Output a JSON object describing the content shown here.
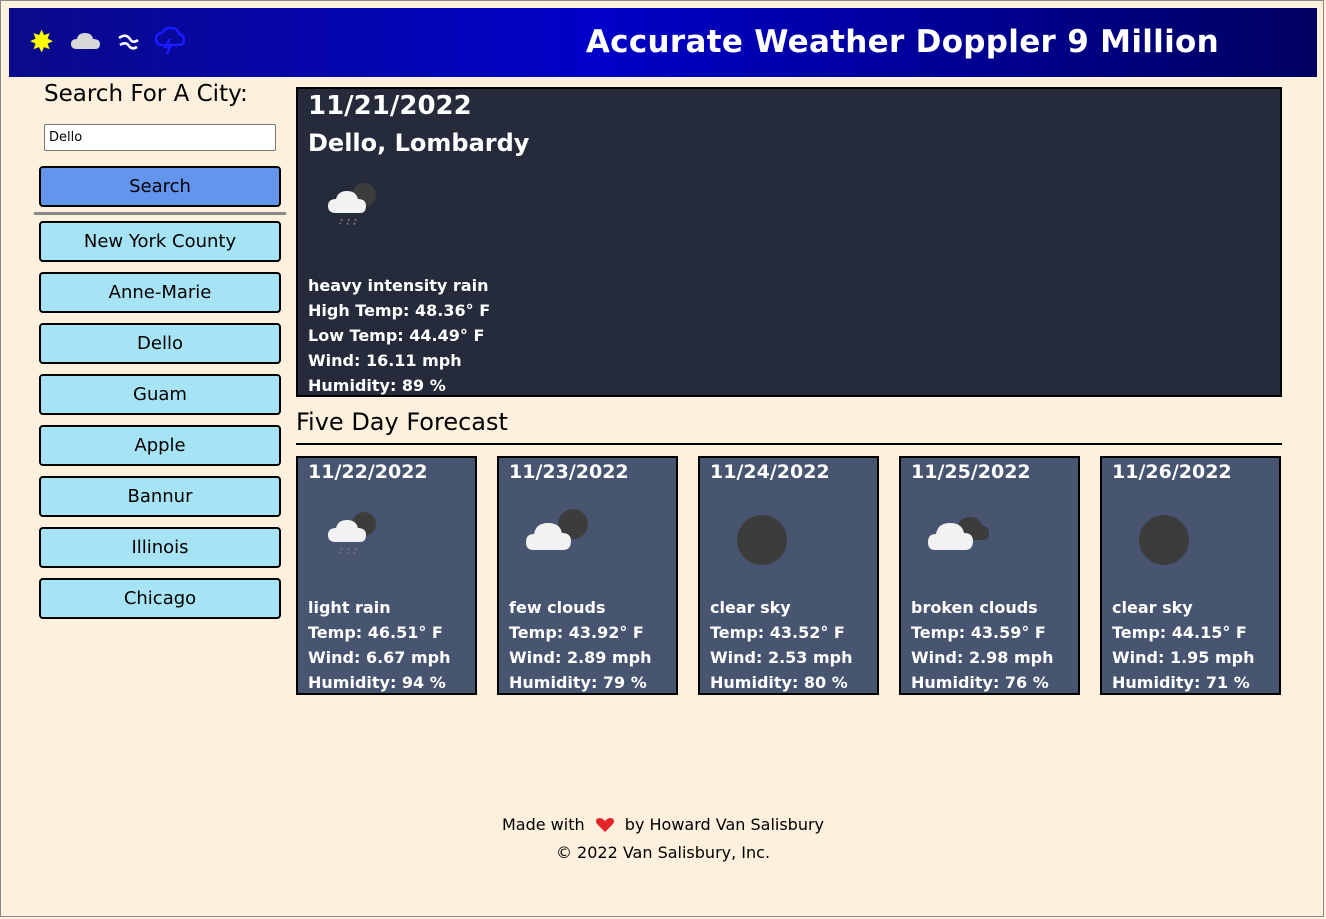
{
  "header": {
    "title": "Accurate Weather Doppler 9 Million",
    "icons": [
      "sun-icon",
      "cloud-icon",
      "wind-icon",
      "storm-icon"
    ]
  },
  "sidebar": {
    "heading": "Search For A City:",
    "search": {
      "value": "Dello",
      "placeholder": ""
    },
    "search_button": "Search",
    "history": [
      "New York County",
      "Anne-Marie",
      "Dello",
      "Guam",
      "Apple",
      "Bannur",
      "Illinois",
      "Chicago"
    ]
  },
  "current": {
    "date": "11/21/2022",
    "location": "Dello, Lombardy",
    "icon": "rain-night-icon",
    "description": "heavy intensity rain",
    "high": "High Temp: 48.36° F",
    "low": "Low Temp: 44.49° F",
    "wind": "Wind: 16.11 mph",
    "humidity": "Humidity: 89 %"
  },
  "forecast": {
    "title": "Five Day Forecast",
    "days": [
      {
        "date": "11/22/2022",
        "icon": "rain-night-icon",
        "description": "light rain",
        "temp": "Temp: 46.51° F",
        "wind": "Wind: 6.67 mph",
        "humidity": "Humidity: 94 %"
      },
      {
        "date": "11/23/2022",
        "icon": "few-clouds-night-icon",
        "description": "few clouds",
        "temp": "Temp: 43.92° F",
        "wind": "Wind: 2.89 mph",
        "humidity": "Humidity: 79 %"
      },
      {
        "date": "11/24/2022",
        "icon": "clear-night-icon",
        "description": "clear sky",
        "temp": "Temp: 43.52° F",
        "wind": "Wind: 2.53 mph",
        "humidity": "Humidity: 80 %"
      },
      {
        "date": "11/25/2022",
        "icon": "broken-clouds-icon",
        "description": "broken clouds",
        "temp": "Temp: 43.59° F",
        "wind": "Wind: 2.98 mph",
        "humidity": "Humidity: 76 %"
      },
      {
        "date": "11/26/2022",
        "icon": "clear-night-icon",
        "description": "clear sky",
        "temp": "Temp: 44.15° F",
        "wind": "Wind: 1.95 mph",
        "humidity": "Humidity: 71 %"
      }
    ]
  },
  "footer": {
    "made_with": "Made with",
    "by": "by Howard Van Salisbury",
    "copyright": "© 2022 Van Salisbury, Inc."
  },
  "colors": {
    "background": "#fdf0dc",
    "header_start": "#0a0a8a",
    "header_end": "#000060",
    "current_card": "#252b3b",
    "forecast_card": "#475571",
    "search_button": "#6495ed",
    "history_button": "#a6e4f5"
  }
}
